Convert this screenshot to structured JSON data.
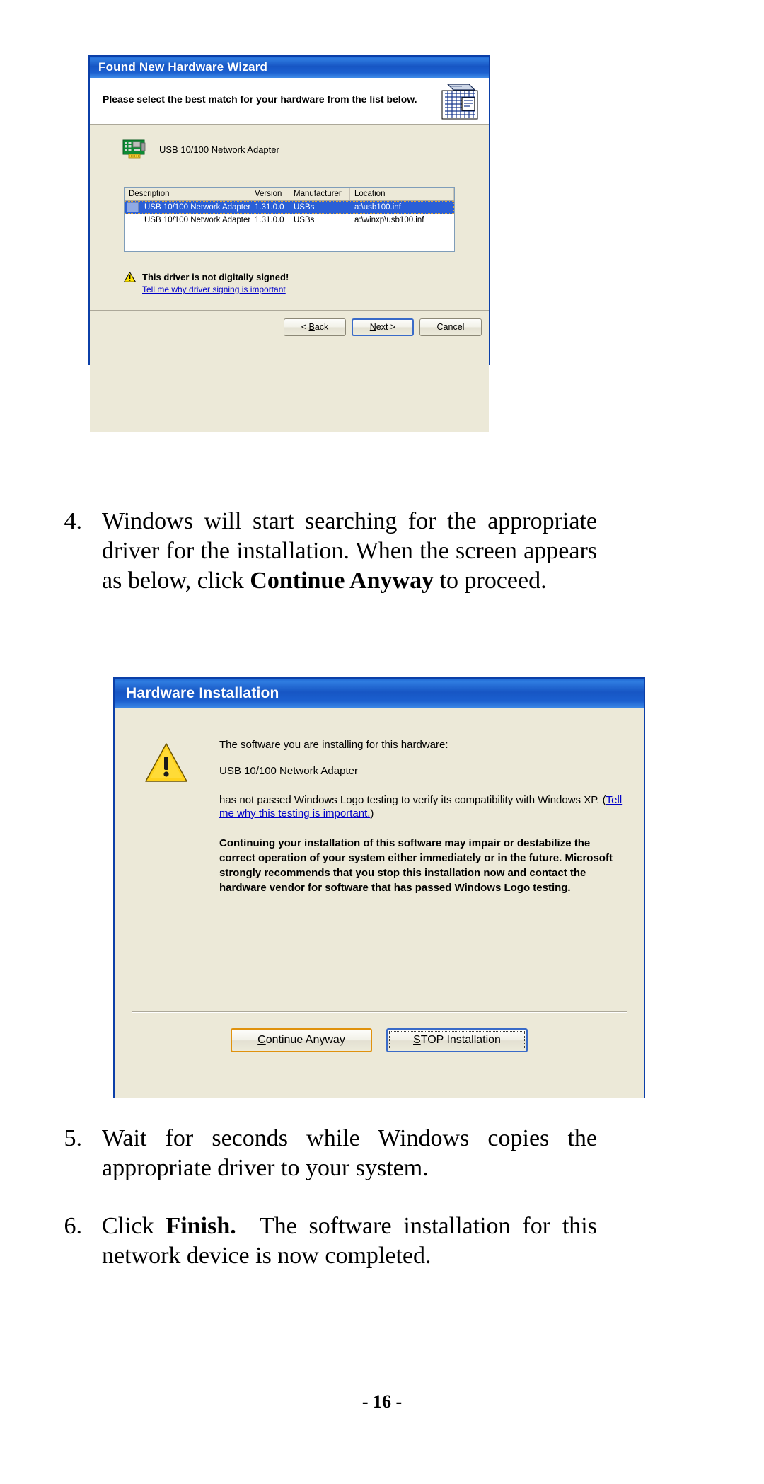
{
  "document": {
    "page_number": "- 16 -",
    "steps": [
      {
        "number": "4.",
        "html": "Windows will start searching for the appropriate driver for the installation. When the screen appears as below, click <b>Continue Anyway</b> to proceed."
      },
      {
        "number": "5.",
        "html": "Wait for seconds while Windows copies the appropriate driver to your system."
      },
      {
        "number": "6.",
        "html": "Click <b>Finish.</b>&nbsp; The software installation for this network device is now completed."
      }
    ]
  },
  "wizard_dialog": {
    "title": "Found New Hardware Wizard",
    "header_text": "Please select the best match for your hardware from the list below.",
    "device_label": "USB 10/100 Network Adapter",
    "list": {
      "columns": [
        "Description",
        "Version",
        "Manufacturer",
        "Location"
      ],
      "rows": [
        {
          "description": "USB 10/100 Network Adapter",
          "version": "1.31.0.0",
          "manufacturer": "USBs",
          "location": "a:\\usb100.inf",
          "selected": true
        },
        {
          "description": "USB 10/100 Network Adapter",
          "version": "1.31.0.0",
          "manufacturer": "USBs",
          "location": "a:\\winxp\\usb100.inf",
          "selected": false
        }
      ]
    },
    "warning": {
      "title": "This driver is not digitally signed!",
      "link": "Tell me why driver signing is important"
    },
    "buttons": {
      "back": "< Back",
      "back_prefix": "< ",
      "back_accel": "B",
      "back_suffix": "ack",
      "next_accel": "N",
      "next_suffix": "ext >",
      "cancel": "Cancel"
    }
  },
  "hardware_dialog": {
    "title": "Hardware Installation",
    "line1": "The software you are installing for this hardware:",
    "line2": "USB 10/100 Network Adapter",
    "line3_part1": "has not passed Windows Logo testing to verify its compatibility with Windows XP. (",
    "line3_link": "Tell me why this testing is important.",
    "line3_part2": ")",
    "bold_paragraph": "Continuing your installation of this software may impair or destabilize the correct operation of your system either immediately or in the future. Microsoft strongly recommends that you stop this installation now and contact the hardware vendor for software that has passed Windows Logo testing.",
    "buttons": {
      "continue_accel": "C",
      "continue_suffix": "ontinue Anyway",
      "stop_accel": "S",
      "stop_suffix": "TOP Installation"
    }
  },
  "colors": {
    "title_bar_blue": "#1b5fcf",
    "dialog_face": "#ece9d8",
    "selection_blue": "#2a5fd6",
    "link_blue": "#0000c8",
    "warning_yellow": "#ffd21c",
    "orange_border": "#e0920d"
  }
}
